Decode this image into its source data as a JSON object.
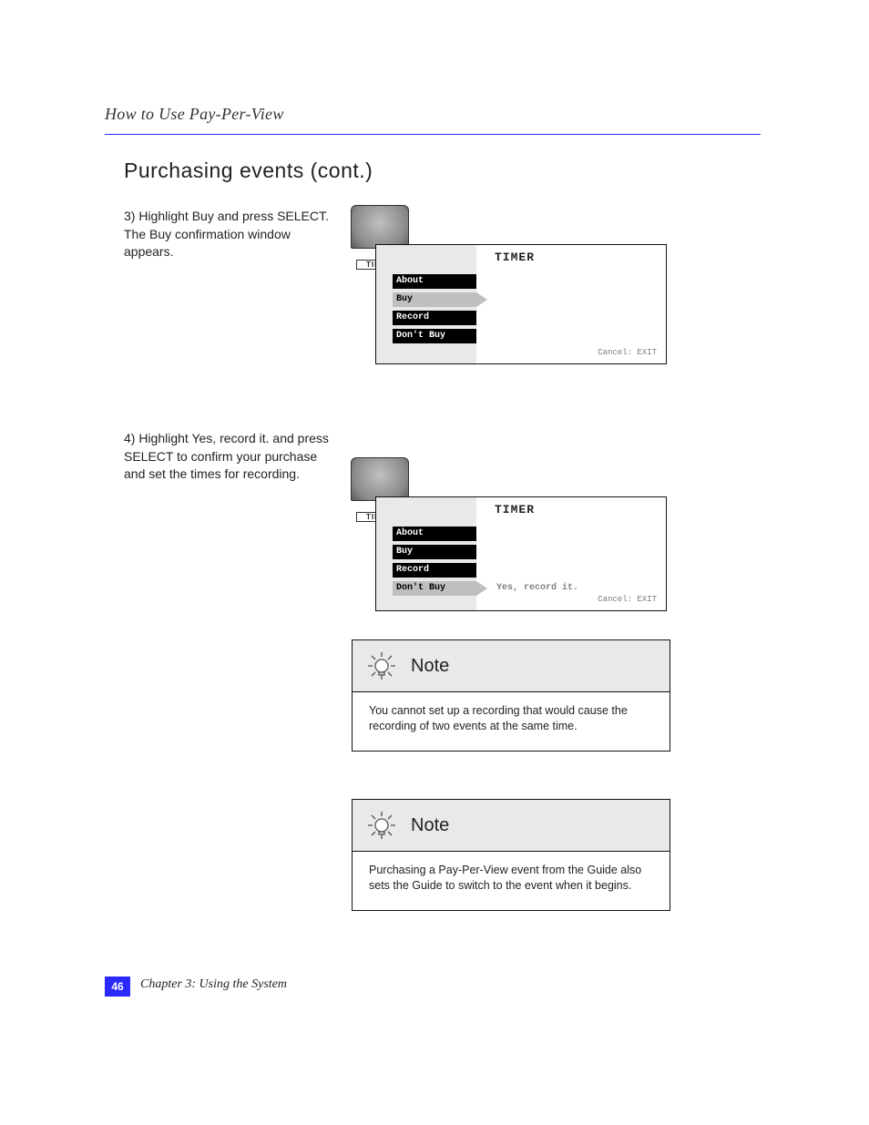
{
  "running_top": "How to Use Pay-Per-View",
  "section_title": "Purchasing events (cont.)",
  "step3": "3) Highlight Buy and press SELECT. The Buy confirmation window appears.",
  "step4": "4) Highlight Yes, record it. and press SELECT to confirm your purchase and set the times for recording.",
  "panel": {
    "title": "TIMER",
    "hint": "Cancel: EXIT",
    "items": [
      {
        "label": "About",
        "value": ""
      },
      {
        "label": "Buy",
        "value": ""
      },
      {
        "label": "Record",
        "value": ""
      },
      {
        "label": "Don't Buy",
        "value": ""
      }
    ],
    "selected_a": 1,
    "selected_b": 3,
    "confirm_value": "Yes, record it."
  },
  "timer_icon_label": "TIMER",
  "notes": [
    {
      "title": "Note",
      "body": "You cannot set up a recording that would cause the recording of two events at the same time."
    },
    {
      "title": "Note",
      "body": "Purchasing a Pay-Per-View event from the Guide also sets the Guide to switch to the event when it begins."
    }
  ],
  "page_number": "46",
  "running_bottom": "Chapter 3: Using the System"
}
